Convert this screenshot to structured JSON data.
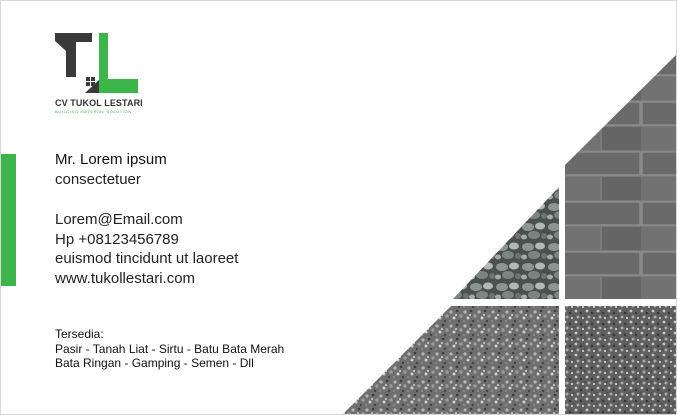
{
  "company": {
    "name": "CV TUKOL LESTARI",
    "tagline": "BUILDING MATERIAL SOLUTION"
  },
  "person": {
    "name": "Mr. Lorem ipsum",
    "title": "consectetuer"
  },
  "contact": {
    "email": "Lorem@Email.com",
    "phone": "Hp +08123456789",
    "address": "euismod tincidunt ut laoreet",
    "website": "www.tukollestari.com"
  },
  "products": {
    "heading": "Tersedia:",
    "line1": "Pasir - Tanah Liat - Sirtu - Batu Bata Merah",
    "line2": "Bata Ringan - Gamping - Semen - Dll"
  },
  "colors": {
    "accent": "#3cb54a",
    "logo_dark": "#3a3a3a"
  },
  "icons": [
    "company-logo-icon"
  ]
}
